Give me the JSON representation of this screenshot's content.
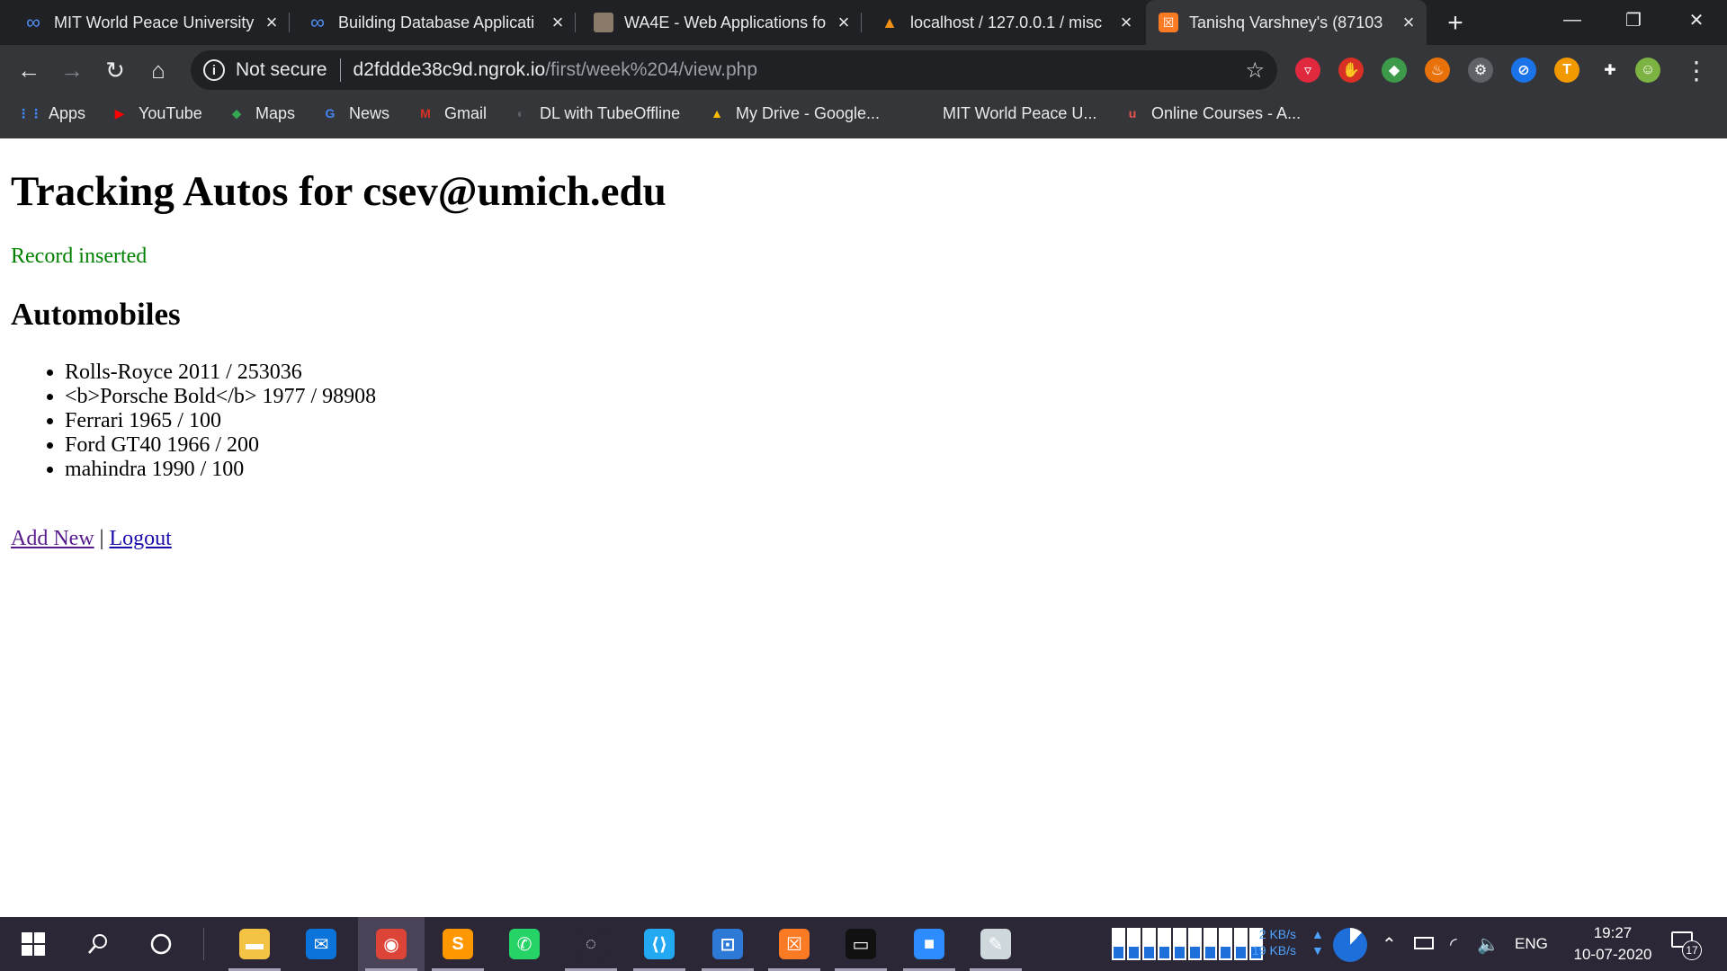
{
  "browser": {
    "tabs": [
      {
        "title": "MIT World Peace University",
        "icon": "infinity-icon"
      },
      {
        "title": "Building Database Applicati",
        "icon": "infinity-icon"
      },
      {
        "title": "WA4E - Web Applications fo",
        "icon": "wa4e-icon"
      },
      {
        "title": "localhost / 127.0.0.1 / misc",
        "icon": "phpmyadmin-icon"
      },
      {
        "title": "Tanishq Varshney's (87103",
        "icon": "xampp-icon"
      }
    ],
    "active_tab_index": 4,
    "new_tab_symbol": "+",
    "window_controls": {
      "minimize": "—",
      "restore": "❐",
      "close": "✕"
    },
    "toolbar": {
      "back": "←",
      "forward": "→",
      "reload": "↻",
      "home": "⌂",
      "security_label": "Not secure",
      "url_host": "d2fddde38c9d.ngrok.io",
      "url_path": "/first/week%204/view.php",
      "star": "☆",
      "menu": "⋮"
    },
    "extensions": [
      {
        "name": "pocket-icon",
        "color": "#e0283e",
        "glyph": "▿"
      },
      {
        "name": "shield-icon",
        "color": "#d93025",
        "glyph": "✋"
      },
      {
        "name": "extension-green-icon",
        "color": "#3c9a4a",
        "glyph": "◆"
      },
      {
        "name": "fire-icon",
        "color": "#e8710a",
        "glyph": "♨"
      },
      {
        "name": "gear-icon",
        "color": "#5f6368",
        "glyph": "⚙"
      },
      {
        "name": "block-icon",
        "color": "#1a73e8",
        "glyph": "⊘"
      },
      {
        "name": "t-extension-icon",
        "color": "#f29900",
        "glyph": "T"
      },
      {
        "name": "puzzle-icon",
        "color": "#35363a",
        "glyph": "✚"
      },
      {
        "name": "profile-avatar-icon",
        "color": "#7cb342",
        "glyph": "☺"
      }
    ],
    "bookmarks": [
      {
        "label": "Apps",
        "icon": "apps-grid-icon",
        "color": "#4285f4",
        "glyph": "⋮⋮"
      },
      {
        "label": "YouTube",
        "icon": "youtube-icon",
        "color": "#ff0000",
        "glyph": "▶"
      },
      {
        "label": "Maps",
        "icon": "maps-icon",
        "color": "#34a853",
        "glyph": "⬥"
      },
      {
        "label": "News",
        "icon": "news-icon",
        "color": "#4285f4",
        "glyph": "G"
      },
      {
        "label": "Gmail",
        "icon": "gmail-icon",
        "color": "#d93025",
        "glyph": "M"
      },
      {
        "label": "DL with TubeOffline",
        "icon": "globe-icon",
        "color": "#5f6368",
        "glyph": "◐"
      },
      {
        "label": "My Drive - Google...",
        "icon": "drive-icon",
        "color": "#fbbc04",
        "glyph": "▲"
      },
      {
        "label": "MIT World Peace U...",
        "icon": "infinity-icon",
        "color": "#35363a",
        "glyph": "∞"
      },
      {
        "label": "Online Courses - A...",
        "icon": "udemy-icon",
        "color": "#ec5252",
        "glyph": "u"
      }
    ]
  },
  "page": {
    "heading": "Tracking Autos for csev@umich.edu",
    "flash": "Record inserted",
    "section_title": "Automobiles",
    "autos": [
      "Rolls-Royce 2011 / 253036",
      "<b>Porsche Bold</b> 1977 / 98908",
      "Ferrari 1965 / 100",
      "Ford GT40 1966 / 200",
      "mahindra 1990 / 100"
    ],
    "links": {
      "add_new": "Add New",
      "separator": "|",
      "logout": "Logout"
    }
  },
  "taskbar": {
    "apps": [
      {
        "name": "file-explorer-icon",
        "color": "#f5c343",
        "glyph": "▬"
      },
      {
        "name": "mail-icon",
        "color": "#0a74da",
        "glyph": "✉"
      },
      {
        "name": "chrome-icon",
        "color": "#db4437",
        "glyph": "◉"
      },
      {
        "name": "sublime-text-icon",
        "color": "#ff9800",
        "glyph": "S"
      },
      {
        "name": "whatsapp-icon",
        "color": "#25d366",
        "glyph": "✆"
      },
      {
        "name": "spinner-app-icon",
        "color": "#2b2736",
        "glyph": "◌"
      },
      {
        "name": "vscode-icon",
        "color": "#23a9f2",
        "glyph": "⟨⟩"
      },
      {
        "name": "xampp-control-icon",
        "color": "#2d7ad6",
        "glyph": "⊡"
      },
      {
        "name": "xampp-icon",
        "color": "#fb7a24",
        "glyph": "☒"
      },
      {
        "name": "terminal-icon",
        "color": "#111111",
        "glyph": "▭"
      },
      {
        "name": "zoom-icon",
        "color": "#2d8cff",
        "glyph": "■"
      },
      {
        "name": "paint-icon",
        "color": "#cfd8dc",
        "glyph": "✎"
      }
    ],
    "active_app_index": 2,
    "net_up": "2 KB/s",
    "net_down": "19 KB/s",
    "language": "ENG",
    "time": "19:27",
    "date": "10-07-2020",
    "notification_count": "17"
  }
}
